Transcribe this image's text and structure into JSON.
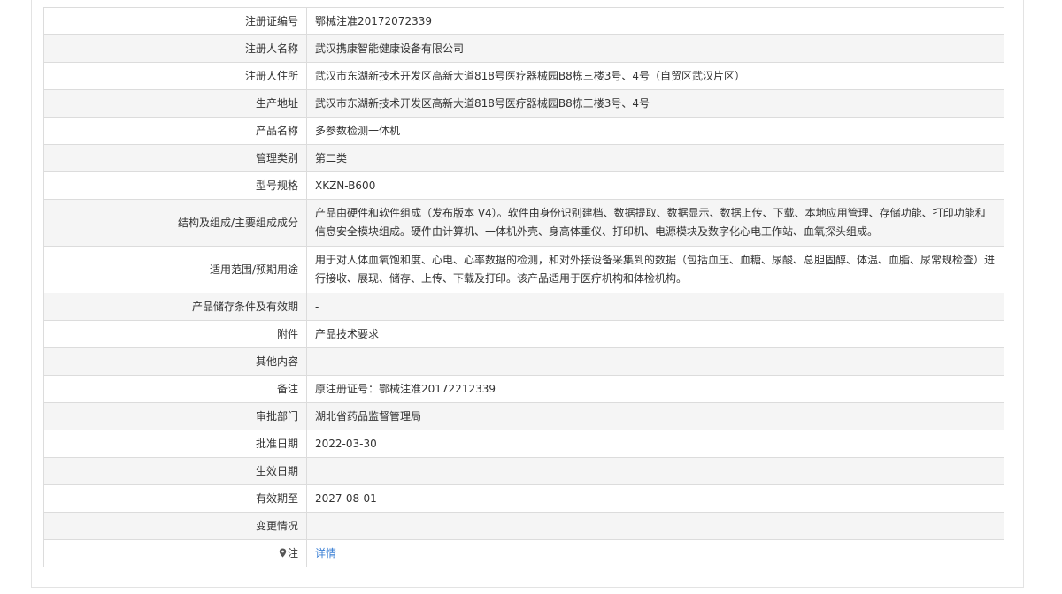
{
  "rows": [
    {
      "label": "注册证编号",
      "value": "鄂械注准20172072339"
    },
    {
      "label": "注册人名称",
      "value": "武汉携康智能健康设备有限公司"
    },
    {
      "label": "注册人住所",
      "value": "武汉市东湖新技术开发区高新大道818号医疗器械园B8栋三楼3号、4号（自贸区武汉片区）"
    },
    {
      "label": "生产地址",
      "value": "武汉市东湖新技术开发区高新大道818号医疗器械园B8栋三楼3号、4号"
    },
    {
      "label": "产品名称",
      "value": "多参数检测一体机"
    },
    {
      "label": "管理类别",
      "value": "第二类"
    },
    {
      "label": "型号规格",
      "value": "XKZN-B600"
    },
    {
      "label": "结构及组成/主要组成成分",
      "value": "产品由硬件和软件组成（发布版本 V4）。软件由身份识别建档、数据提取、数据显示、数据上传、下载、本地应用管理、存储功能、打印功能和信息安全模块组成。硬件由计算机、一体机外壳、身高体重仪、打印机、电源模块及数字化心电工作站、血氧探头组成。"
    },
    {
      "label": "适用范围/预期用途",
      "value": "用于对人体血氧饱和度、心电、心率数据的检测，和对外接设备采集到的数据（包括血压、血糖、尿酸、总胆固醇、体温、血脂、尿常规检查）进行接收、展现、储存、上传、下载及打印。该产品适用于医疗机构和体检机构。"
    },
    {
      "label": "产品储存条件及有效期",
      "value": "-"
    },
    {
      "label": "附件",
      "value": "产品技术要求"
    },
    {
      "label": "其他内容",
      "value": ""
    },
    {
      "label": "备注",
      "value": "原注册证号：鄂械注准20172212339"
    },
    {
      "label": "审批部门",
      "value": "湖北省药品监督管理局"
    },
    {
      "label": "批准日期",
      "value": "2022-03-30"
    },
    {
      "label": "生效日期",
      "value": ""
    },
    {
      "label": "有效期至",
      "value": "2027-08-01"
    },
    {
      "label": "变更情况",
      "value": ""
    }
  ],
  "note": {
    "label": "注",
    "icon": "map-pin-icon",
    "link_text": "详情",
    "link_color": "#3a7fd5"
  }
}
